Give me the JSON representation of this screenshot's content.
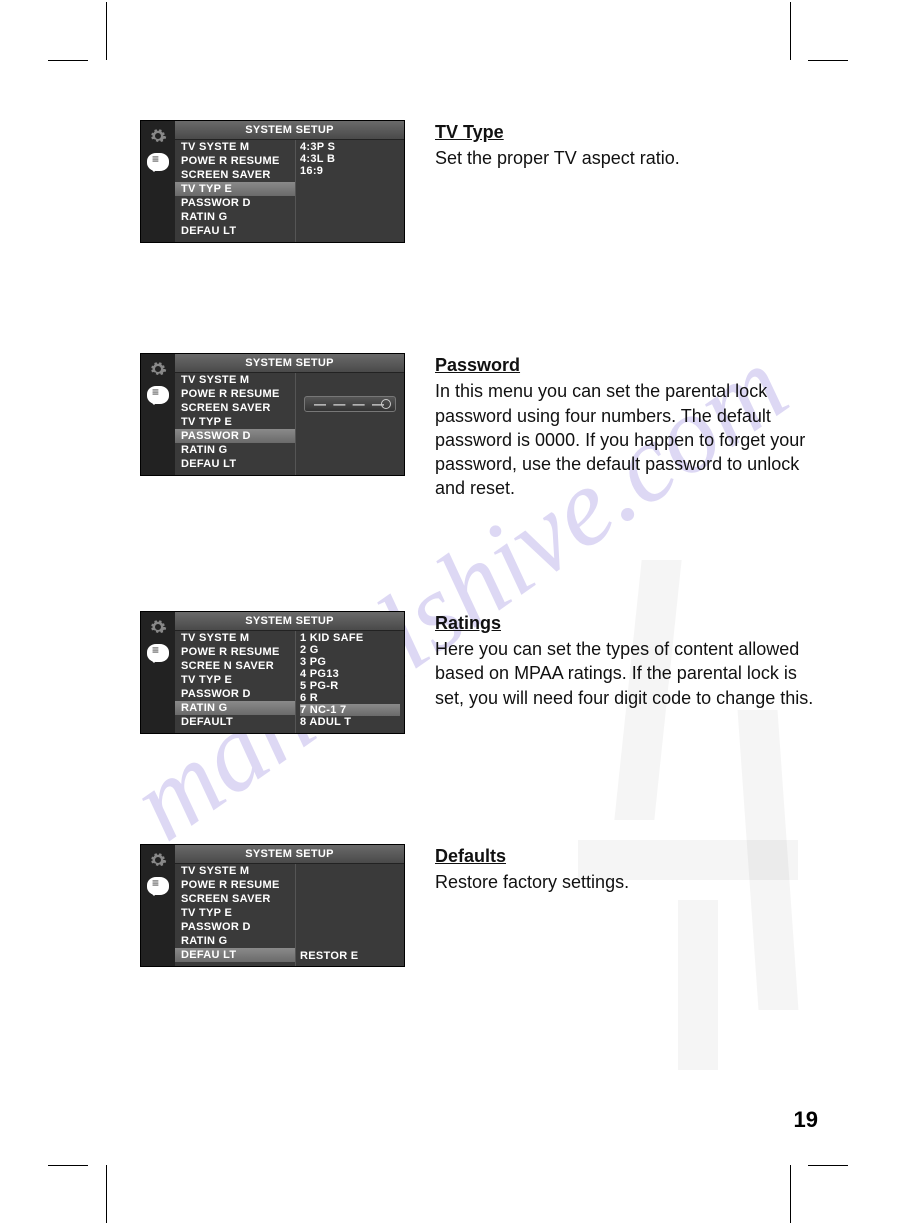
{
  "page_number": "19",
  "watermark": "manualshive.com",
  "osd_title": "SYSTEM  SETUP",
  "base_menu": [
    "TV SYSTE M",
    "POWE R RESUME",
    "SCREEN  SAVER",
    "TV TYP E",
    "PASSWOR D",
    "RATIN G",
    "DEFAU LT"
  ],
  "sections": {
    "tvtype": {
      "title": "TV Type",
      "text": "Set the proper TV aspect ratio.",
      "selected": 3,
      "options": [
        "4:3P S",
        "4:3L B",
        "16:9"
      ]
    },
    "password": {
      "title": "Password",
      "text": "In this menu you can set the parental lock password using four numbers. The default password is 0000. If you happen to forget your password, use the default password to unlock and reset.",
      "selected": 4,
      "field": "— — — —"
    },
    "ratings": {
      "title": "Ratings",
      "text": "Here you can set the types of content allowed based on MPAA ratings. If the parental lock is set, you will need four digit code to change this.",
      "selected": 5,
      "options": [
        "1 KID SAFE",
        "2 G",
        "3 PG",
        "4 PG13",
        "5 PG-R",
        "6 R",
        "7 NC-1 7",
        "8 ADUL T"
      ],
      "opt_selected": 6,
      "menu_override": [
        "TV SYSTE M",
        "POWE R RESUME",
        "SCREE N SAVER",
        "TV TYP E",
        "PASSWOR D",
        "RATIN G",
        "DEFAULT"
      ]
    },
    "defaults": {
      "title": "Defaults",
      "text": "Restore factory settings.",
      "selected": 6,
      "options": [
        "RESTOR E"
      ]
    }
  }
}
